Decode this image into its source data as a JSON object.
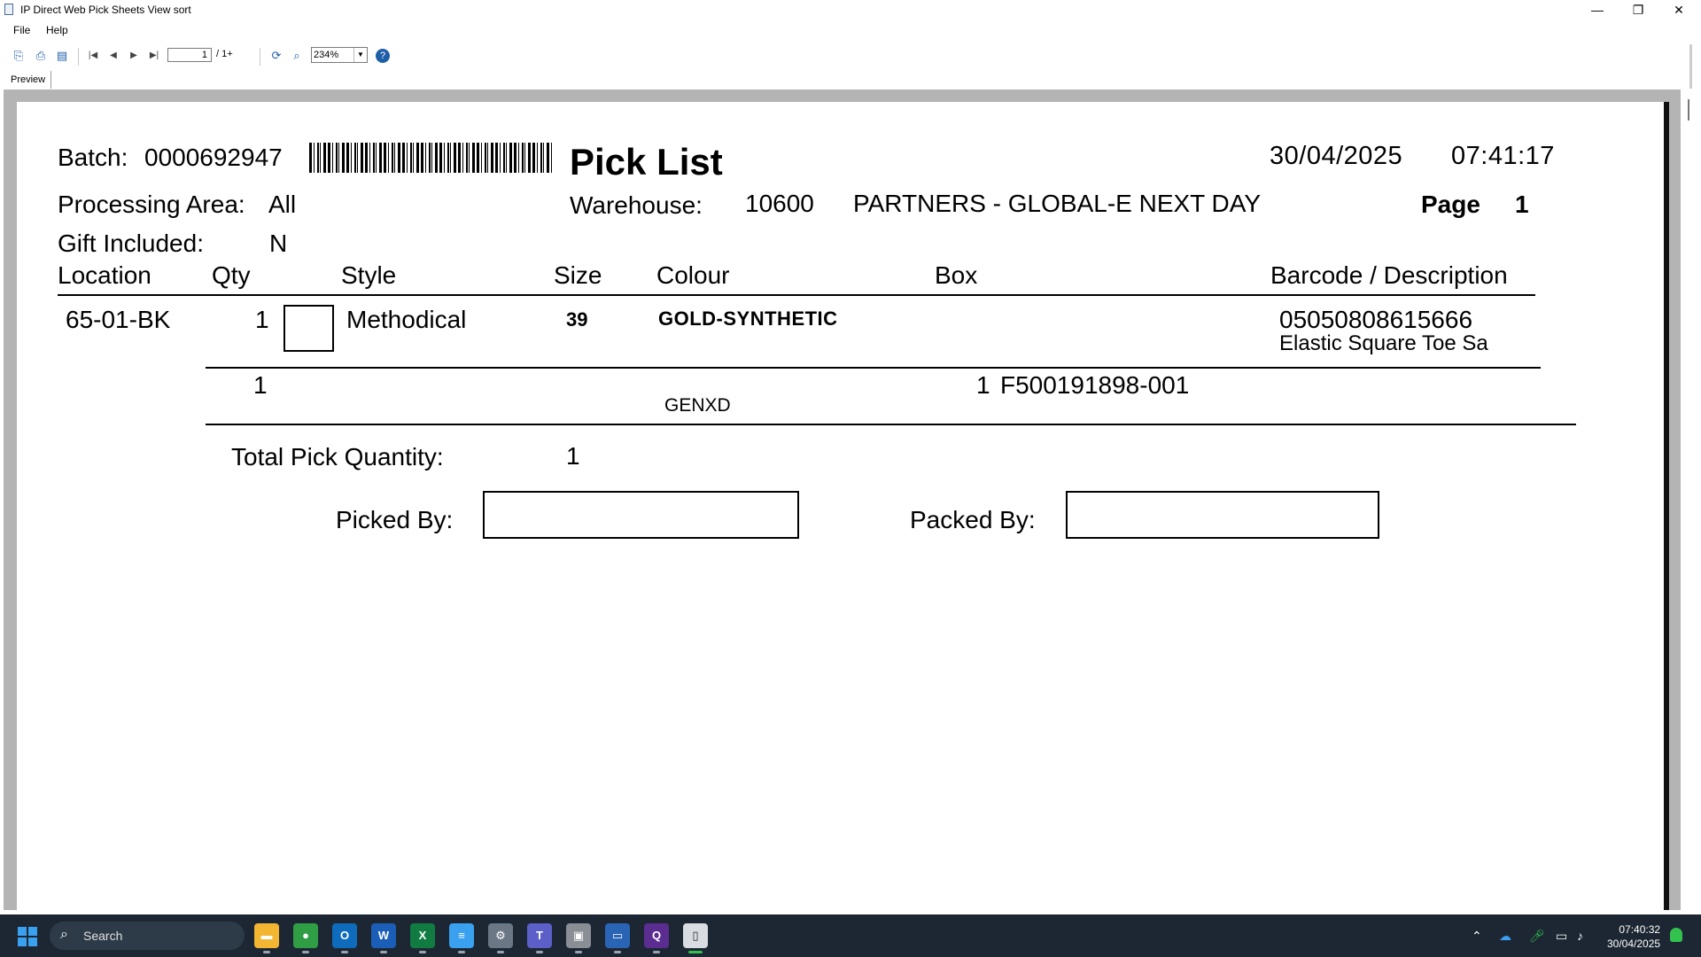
{
  "window": {
    "title": "IP Direct Web Pick Sheets View sort",
    "minimize": "—",
    "restore": "❐",
    "close": "✕"
  },
  "menu": [
    "File",
    "Help"
  ],
  "toolbar": {
    "page_current": "1",
    "page_total": "/ 1+",
    "zoom": "234%",
    "icons": [
      "export-icon",
      "print-icon",
      "group-tree-icon",
      "first-page-icon",
      "previous-page-icon",
      "next-page-icon",
      "last-page-icon",
      "refresh-icon",
      "find-icon",
      "help-icon"
    ]
  },
  "tabs": [
    "Preview"
  ],
  "report": {
    "batch_label": "Batch:",
    "batch_value": "0000692947",
    "title": "Pick List",
    "date": "30/04/2025",
    "time": "07:41:17",
    "processing_area_label": "Processing Area:",
    "processing_area_value": "All",
    "warehouse_label": "Warehouse:",
    "warehouse_code": "10600",
    "warehouse_name": "PARTNERS - GLOBAL-E NEXT DAY",
    "page_label": "Page",
    "page_number": "1",
    "gift_label": "Gift Included:",
    "gift_value": "N",
    "columns": {
      "location": "Location",
      "qty": "Qty",
      "style": "Style",
      "size": "Size",
      "colour": "Colour",
      "box": "Box",
      "barcode": "Barcode / Description"
    },
    "line": {
      "location": "65-01-BK",
      "qty": "1",
      "style": "Methodical",
      "size": "39",
      "colour": "GOLD-SYNTHETIC",
      "barcode": "05050808615666",
      "description": "Elastic Square Toe Sa"
    },
    "subline": {
      "qty": "1",
      "code": "GENXD",
      "box_qty": "1",
      "box_ref": "F500191898-001"
    },
    "total_label": "Total Pick Quantity:",
    "total_value": "1",
    "picked_by_label": "Picked By:",
    "packed_by_label": "Packed By:"
  },
  "taskbar": {
    "search_placeholder": "Search",
    "apps": [
      {
        "name": "file-explorer",
        "glyph": "▬",
        "color": "#f2b632"
      },
      {
        "name": "chrome",
        "glyph": "●",
        "color": "#2f9e44"
      },
      {
        "name": "outlook",
        "glyph": "O",
        "color": "#0f6cbd"
      },
      {
        "name": "word",
        "glyph": "W",
        "color": "#1b5eb8"
      },
      {
        "name": "excel",
        "glyph": "X",
        "color": "#107c41"
      },
      {
        "name": "notepad",
        "glyph": "≡",
        "color": "#3aa0f0"
      },
      {
        "name": "settings",
        "glyph": "⚙",
        "color": "#6b7785"
      },
      {
        "name": "teams",
        "glyph": "T",
        "color": "#5b5fc7"
      },
      {
        "name": "remote-app",
        "glyph": "▣",
        "color": "#8a8f96"
      },
      {
        "name": "crystal-app",
        "glyph": "▭",
        "color": "#2a64b5"
      },
      {
        "name": "query-app",
        "glyph": "Q",
        "color": "#5c2d91"
      },
      {
        "name": "active-viewer",
        "glyph": "▯",
        "color": "#d9dde2"
      }
    ],
    "time": "07:40:32",
    "date": "30/04/2025"
  }
}
